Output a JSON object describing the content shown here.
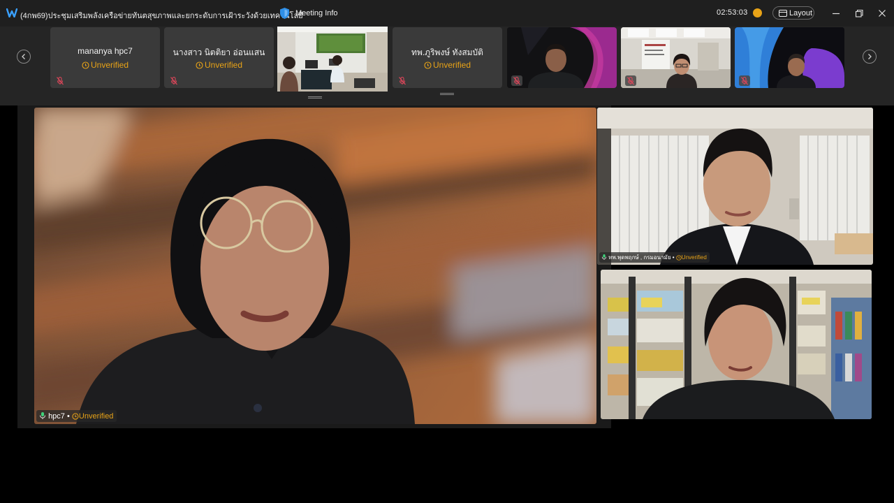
{
  "window": {
    "title": "(4กพ69)ประชุมเสริมพลังเครือข่ายทันตสุขภาพและยกระดับการเฝ้าระวังด้วยเทคโนโลยี",
    "meeting_info": "Meeting Info",
    "timer": "02:53:03",
    "layout_label": "Layout",
    "icons": [
      "app-logo-icon",
      "shield-icon",
      "network-status-icon",
      "layout-icon",
      "minimize-icon",
      "restore-icon",
      "close-icon"
    ]
  },
  "participants_strip": {
    "tiles": [
      {
        "name": "mananya hpc7",
        "status": "Unverified",
        "video": false,
        "mic": "muted"
      },
      {
        "name": "นางสาว นิตติยา  อ่อนแสน",
        "status": "Unverified",
        "video": false,
        "mic": "muted"
      },
      {
        "name": "",
        "status": "",
        "video": true,
        "mic": "none"
      },
      {
        "name": "ทพ.ภูริพงษ์ ทังสมบัติ",
        "status": "Unverified",
        "video": false,
        "mic": "muted"
      },
      {
        "name": "",
        "status": "",
        "video": true,
        "mic": "muted"
      },
      {
        "name": "",
        "status": "",
        "video": true,
        "mic": "muted"
      },
      {
        "name": "",
        "status": "",
        "video": true,
        "mic": "muted"
      }
    ],
    "icons": [
      "chevron-left-icon",
      "chevron-right-icon",
      "mic-off-icon",
      "unverified-icon"
    ]
  },
  "main_video": {
    "name": "hpc7",
    "separator": "•",
    "status": "Unverified"
  },
  "side_videos": [
    {
      "name": "ทพ.พุดพฤกษ์ , กรมอนามัย",
      "separator": "•",
      "status": "Unverified"
    },
    {
      "name": "",
      "status": ""
    }
  ],
  "colors": {
    "unverified": "#e8a317",
    "titlebar": "#1f1f1f",
    "strip": "#252525",
    "tile": "#3a3a3a"
  }
}
